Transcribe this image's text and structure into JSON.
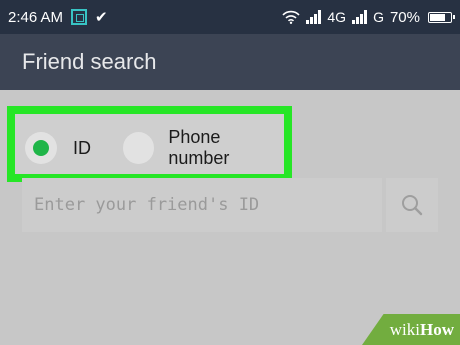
{
  "status_bar": {
    "time": "2:46 AM",
    "network_1": "4G",
    "network_2": "G",
    "battery": "70%"
  },
  "header": {
    "title": "Friend search"
  },
  "search_type": {
    "options": [
      {
        "label": "ID",
        "selected": true
      },
      {
        "label": "Phone number",
        "selected": false
      }
    ]
  },
  "search": {
    "placeholder": "Enter your friend's ID",
    "value": ""
  },
  "watermark": {
    "wiki": "wiki",
    "how": "How"
  },
  "colors": {
    "highlight": "#26e626",
    "radio_selected": "#1fb548",
    "header_bg": "#3c4454",
    "status_bg": "#273142"
  }
}
